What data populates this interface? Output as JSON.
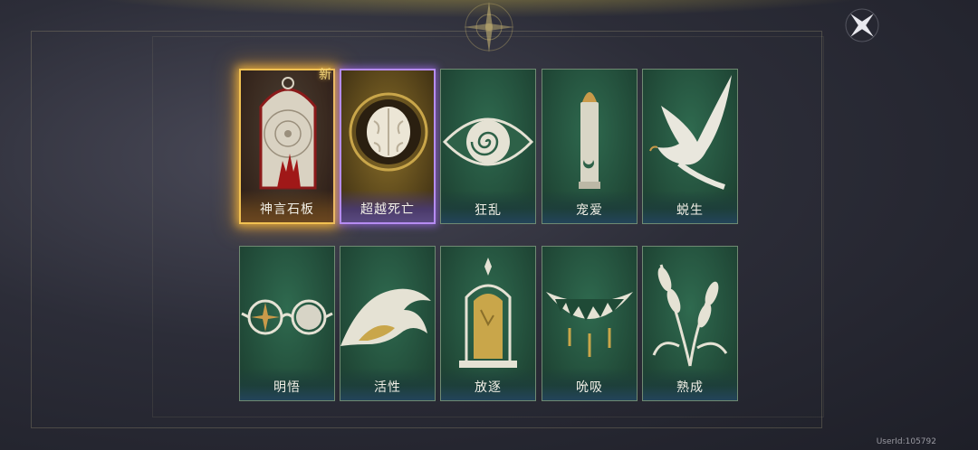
{
  "new_badge": "新",
  "user_id": "UserId:105792",
  "cards": [
    {
      "label": "神言石板",
      "style": "gold",
      "icon": "stone-tablet-hand-icon"
    },
    {
      "label": "超越死亡",
      "style": "purple",
      "icon": "brain-icon"
    },
    {
      "label": "狂乱",
      "style": "green",
      "icon": "spiral-eye-icon"
    },
    {
      "label": "宠爱",
      "style": "green",
      "icon": "bullet-icon"
    },
    {
      "label": "蜕生",
      "style": "green",
      "icon": "dove-icon"
    },
    {
      "label": "明悟",
      "style": "green",
      "icon": "spectacles-icon"
    },
    {
      "label": "活性",
      "style": "green",
      "icon": "wave-icon"
    },
    {
      "label": "放逐",
      "style": "green",
      "icon": "tombstone-icon"
    },
    {
      "label": "吮吸",
      "style": "green",
      "icon": "fanged-mouth-icon"
    },
    {
      "label": "熟成",
      "style": "green",
      "icon": "wheat-icon"
    }
  ]
}
